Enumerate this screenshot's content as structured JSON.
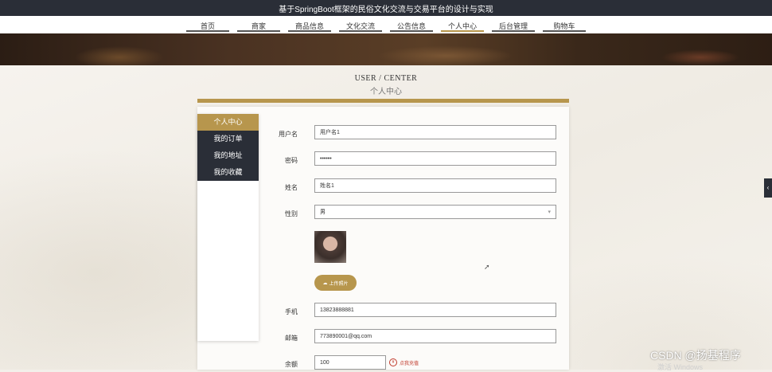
{
  "page_title": "基于SpringBoot框架的民俗文化交流与交易平台的设计与实现",
  "nav": {
    "items": [
      "首页",
      "商家",
      "商品信息",
      "文化交流",
      "公告信息",
      "个人中心",
      "后台管理",
      "购物车"
    ],
    "active_index": 5
  },
  "section": {
    "title_en": "USER / CENTER",
    "title_cn": "个人中心"
  },
  "sidebar": {
    "items": [
      "个人中心",
      "我的订单",
      "我的地址",
      "我的收藏"
    ],
    "active_index": 0
  },
  "form": {
    "username": {
      "label": "用户名",
      "value": "用户名1"
    },
    "password": {
      "label": "密码",
      "value": "••••••"
    },
    "name": {
      "label": "姓名",
      "value": "姓名1"
    },
    "gender": {
      "label": "性别",
      "value": "男"
    },
    "upload_label": "上传照片",
    "phone": {
      "label": "手机",
      "value": "13823888881"
    },
    "email": {
      "label": "邮箱",
      "value": "773890001@qq.com"
    },
    "balance": {
      "label": "余额",
      "value": "100"
    },
    "recharge_label": "点我充值"
  },
  "watermark": "CSDN @扬基程序",
  "os_notice": "激活 Windows",
  "colors": {
    "accent": "#b7964d",
    "dark": "#2a2e37"
  }
}
